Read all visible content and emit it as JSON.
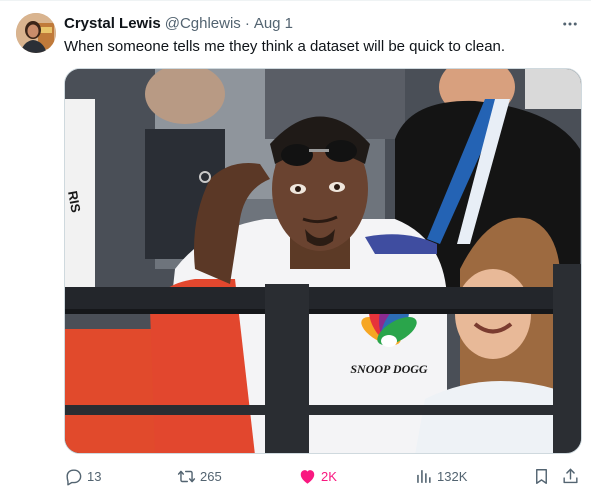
{
  "tweet": {
    "display_name": "Crystal Lewis",
    "handle": "@Cghlewis",
    "separator": "·",
    "date": "Aug 1",
    "text": "When someone tells me they think a dataset will be quick to clean."
  },
  "media": {
    "shirt_logo_text": "SNOOP DOGG",
    "bib_text": "RIS"
  },
  "actions": {
    "replies": "13",
    "reposts": "265",
    "likes": "2K",
    "views": "132K"
  },
  "colors": {
    "text_primary": "#0f1419",
    "text_secondary": "#536471",
    "like_active": "#f91880",
    "border": "#cfd9de"
  },
  "icons": {
    "more": "more-horizontal-icon",
    "reply": "reply-icon",
    "repost": "repost-icon",
    "like": "heart-filled-icon",
    "views": "views-chart-icon",
    "bookmark": "bookmark-icon",
    "share": "share-icon"
  }
}
